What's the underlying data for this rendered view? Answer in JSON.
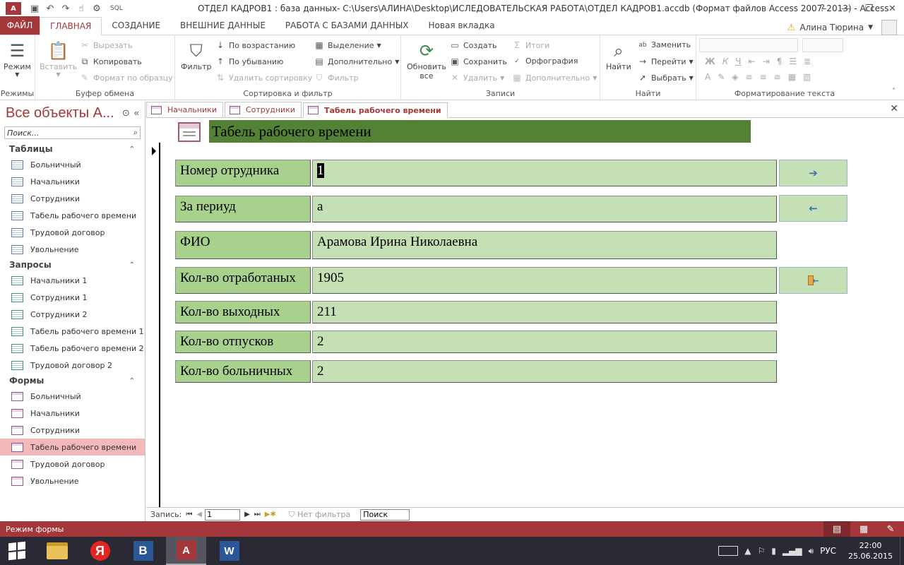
{
  "window": {
    "title": "ОТДЕЛ КАДРОВ1 : база данных- C:\\Users\\АЛИНА\\Desktop\\ИСЛЕДОВАТЕЛЬСКАЯ РАБОТА\\ОТДЕЛ КАДРОВ1.accdb (Формат файлов Access 2007–2013) - Access",
    "app_logo": "A",
    "qat_sql": "SQL"
  },
  "ribbon_tabs": {
    "file": "ФАЙЛ",
    "tabs": [
      "ГЛАВНАЯ",
      "СОЗДАНИЕ",
      "ВНЕШНИЕ ДАННЫЕ",
      "РАБОТА С БАЗАМИ ДАННЫХ",
      "Новая вкладка"
    ],
    "user": "Алина Тюрина"
  },
  "ribbon": {
    "views": {
      "view_btn": "Режим",
      "label": "Режимы"
    },
    "clipboard": {
      "paste": "Вставить",
      "cut": "Вырезать",
      "copy": "Копировать",
      "format_painter": "Формат по образцу",
      "label": "Буфер обмена"
    },
    "sort_filter": {
      "filter": "Фильтр",
      "ascending": "По возрастанию",
      "descending": "По убыванию",
      "remove_sort": "Удалить сортировку",
      "selection": "Выделение",
      "advanced": "Дополнительно",
      "toggle_filter": "Фильтр",
      "label": "Сортировка и фильтр"
    },
    "records": {
      "refresh": "Обновить",
      "refresh_all": "все",
      "new": "Создать",
      "save": "Сохранить",
      "delete": "Удалить",
      "totals": "Итоги",
      "spelling": "Орфография",
      "more": "Дополнительно",
      "label": "Записи"
    },
    "find": {
      "find": "Найти",
      "replace": "Заменить",
      "goto": "Перейти",
      "select": "Выбрать",
      "label": "Найти"
    },
    "text_format": {
      "bold": "Ж",
      "italic": "К",
      "underline": "Ч",
      "font_color": "A",
      "label": "Форматирование текста"
    }
  },
  "navpane": {
    "title": "Все объекты А...",
    "search_placeholder": "Поиск...",
    "sections": [
      {
        "name": "Таблицы",
        "items": [
          "Больничный",
          "Начальники",
          "Сотрудники",
          "Табель рабочего времени",
          "Трудовой договор",
          "Увольнение"
        ]
      },
      {
        "name": "Запросы",
        "items": [
          "Начальники 1",
          "Сотрудники 1",
          "Сотрудники 2",
          "Табель рабочего времени 1",
          "Табель рабочего времени 2",
          "Трудовой договор 2"
        ]
      },
      {
        "name": "Формы",
        "items": [
          "Больничный",
          "Начальники",
          "Сотрудники",
          "Табель рабочего времени",
          "Трудовой договор",
          "Увольнение"
        ]
      }
    ],
    "selected": "Формы / Табель рабочего времени"
  },
  "doc_tabs": [
    "Начальники",
    "Сотрудники",
    "Табель рабочего времени"
  ],
  "form": {
    "title": "Табель рабочего времени",
    "fields": [
      {
        "label": "Номер отрудника",
        "value": "1"
      },
      {
        "label": "За периуд",
        "value": "а"
      },
      {
        "label": "ФИО",
        "value": "Арамова Ирина Николаевна"
      },
      {
        "label": "Кол-во отработаных",
        "value": "1905"
      },
      {
        "label": "Кол-во выходных",
        "value": "211"
      },
      {
        "label": "Кол-во отпусков",
        "value": "2"
      },
      {
        "label": "Кол-во больничных",
        "value": "2"
      }
    ],
    "buttons": {
      "next": "➔",
      "prev": "←"
    }
  },
  "record_bar": {
    "label": "Запись:",
    "current": "1",
    "filter": "Нет фильтра",
    "search": "Поиск"
  },
  "status": {
    "text": "Режим формы"
  },
  "taskbar": {
    "yandex": "Я",
    "word_b": "B",
    "access": "A",
    "word": "W",
    "lang": "РУС",
    "time": "22:00",
    "date": "25.06.2015"
  }
}
